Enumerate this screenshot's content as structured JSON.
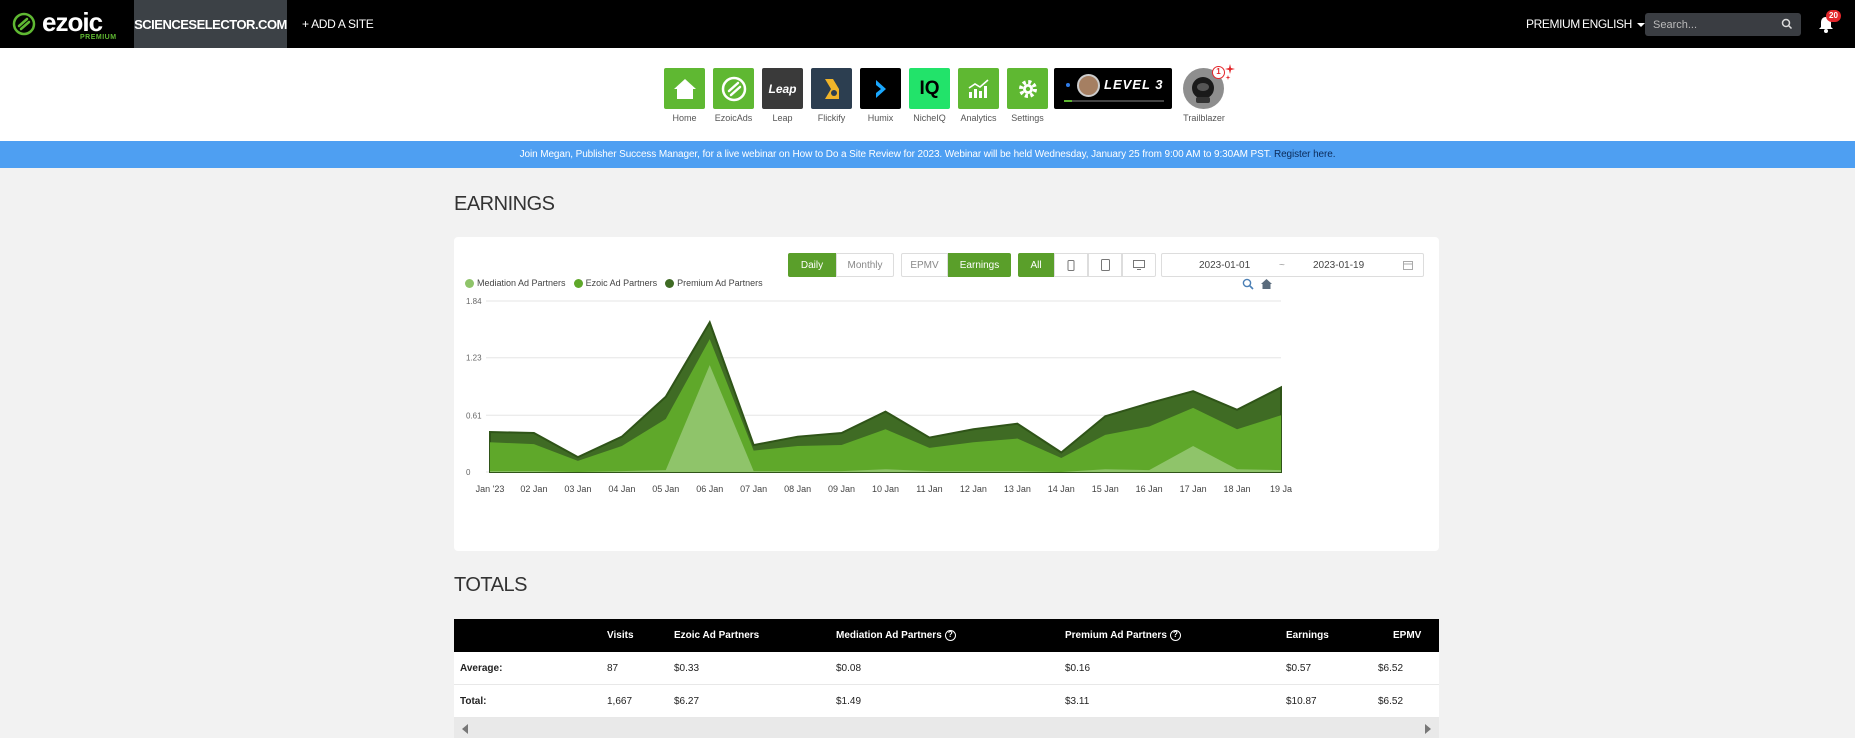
{
  "nav": {
    "logo_text": "ezoic",
    "logo_sub": "PREMIUM",
    "site": "SCIENCESELECTOR.COM",
    "add_site": "+ ADD A SITE",
    "premium": "PREMIUM",
    "language": "ENGLISH",
    "search_placeholder": "Search...",
    "notifications": "20"
  },
  "apps": [
    {
      "label": "Home",
      "color": "#5fb832"
    },
    {
      "label": "EzoicAds",
      "color": "#5fb832"
    },
    {
      "label": "Leap",
      "color": "#333333",
      "tile_text": "Leap"
    },
    {
      "label": "Flickify",
      "color": "#2c3e50"
    },
    {
      "label": "Humix",
      "color": "#000000"
    },
    {
      "label": "NicheIQ",
      "color": "#22e36a",
      "tile_text": "IQ"
    },
    {
      "label": "Analytics",
      "color": "#5fb832"
    },
    {
      "label": "Settings",
      "color": "#5fb832"
    }
  ],
  "level": {
    "text": "LEVEL 3"
  },
  "trailblazer": {
    "label": "Trailblazer",
    "badge": "1"
  },
  "banner": {
    "text": "Join Megan, Publisher Success Manager, for a live webinar on How to Do a Site Review for 2023. Webinar will be held Wednesday, January 25 from 9:00 AM to 9:30AM PST.",
    "link": "Register here."
  },
  "earnings_title": "EARNINGS",
  "totals_title": "TOTALS",
  "controls": {
    "period": [
      "Daily",
      "Monthly"
    ],
    "metric": [
      "EPMV",
      "Earnings"
    ],
    "device_all": "All",
    "date_from": "2023-01-01",
    "date_sep": "~",
    "date_to": "2023-01-19"
  },
  "colors": {
    "mediation": "#8fc46a",
    "ezoic": "#5fa82a",
    "premium": "#3f6b24",
    "accent": "#5a9f2a"
  },
  "chart_data": {
    "type": "area",
    "stacked": true,
    "x": [
      "Jan '23",
      "02 Jan",
      "03 Jan",
      "04 Jan",
      "05 Jan",
      "06 Jan",
      "07 Jan",
      "08 Jan",
      "09 Jan",
      "10 Jan",
      "11 Jan",
      "12 Jan",
      "13 Jan",
      "14 Jan",
      "15 Jan",
      "16 Jan",
      "17 Jan",
      "18 Jan",
      "19 Ja"
    ],
    "yticks": [
      "0",
      "0.61",
      "1.23",
      "1.84"
    ],
    "ylim": [
      0,
      1.84
    ],
    "series": [
      {
        "name": "Mediation Ad Partners",
        "values": [
          0.01,
          0.01,
          0.0,
          0.01,
          0.02,
          1.15,
          0.01,
          0.01,
          0.01,
          0.03,
          0.01,
          0.01,
          0.01,
          0.0,
          0.03,
          0.02,
          0.28,
          0.03,
          0.02
        ]
      },
      {
        "name": "Ezoic Ad Partners",
        "values": [
          0.31,
          0.29,
          0.12,
          0.27,
          0.55,
          0.28,
          0.22,
          0.27,
          0.28,
          0.43,
          0.25,
          0.31,
          0.35,
          0.15,
          0.37,
          0.47,
          0.41,
          0.43,
          0.59
        ]
      },
      {
        "name": "Premium Ad Partners",
        "values": [
          0.11,
          0.12,
          0.04,
          0.1,
          0.24,
          0.18,
          0.06,
          0.1,
          0.13,
          0.19,
          0.11,
          0.14,
          0.16,
          0.06,
          0.2,
          0.25,
          0.18,
          0.21,
          0.3
        ]
      }
    ],
    "legend": "top-left",
    "grid": true
  },
  "totals": {
    "headers": [
      "Visits",
      "Ezoic Ad Partners",
      "Mediation Ad Partners",
      "Premium Ad Partners",
      "Earnings",
      "EPMV"
    ],
    "rows": [
      {
        "label": "Average:",
        "values": [
          "87",
          "$0.33",
          "$0.08",
          "$0.16",
          "$0.57",
          "$6.52"
        ]
      },
      {
        "label": "Total:",
        "values": [
          "1,667",
          "$6.27",
          "$1.49",
          "$3.11",
          "$10.87",
          "$6.52"
        ]
      }
    ]
  }
}
